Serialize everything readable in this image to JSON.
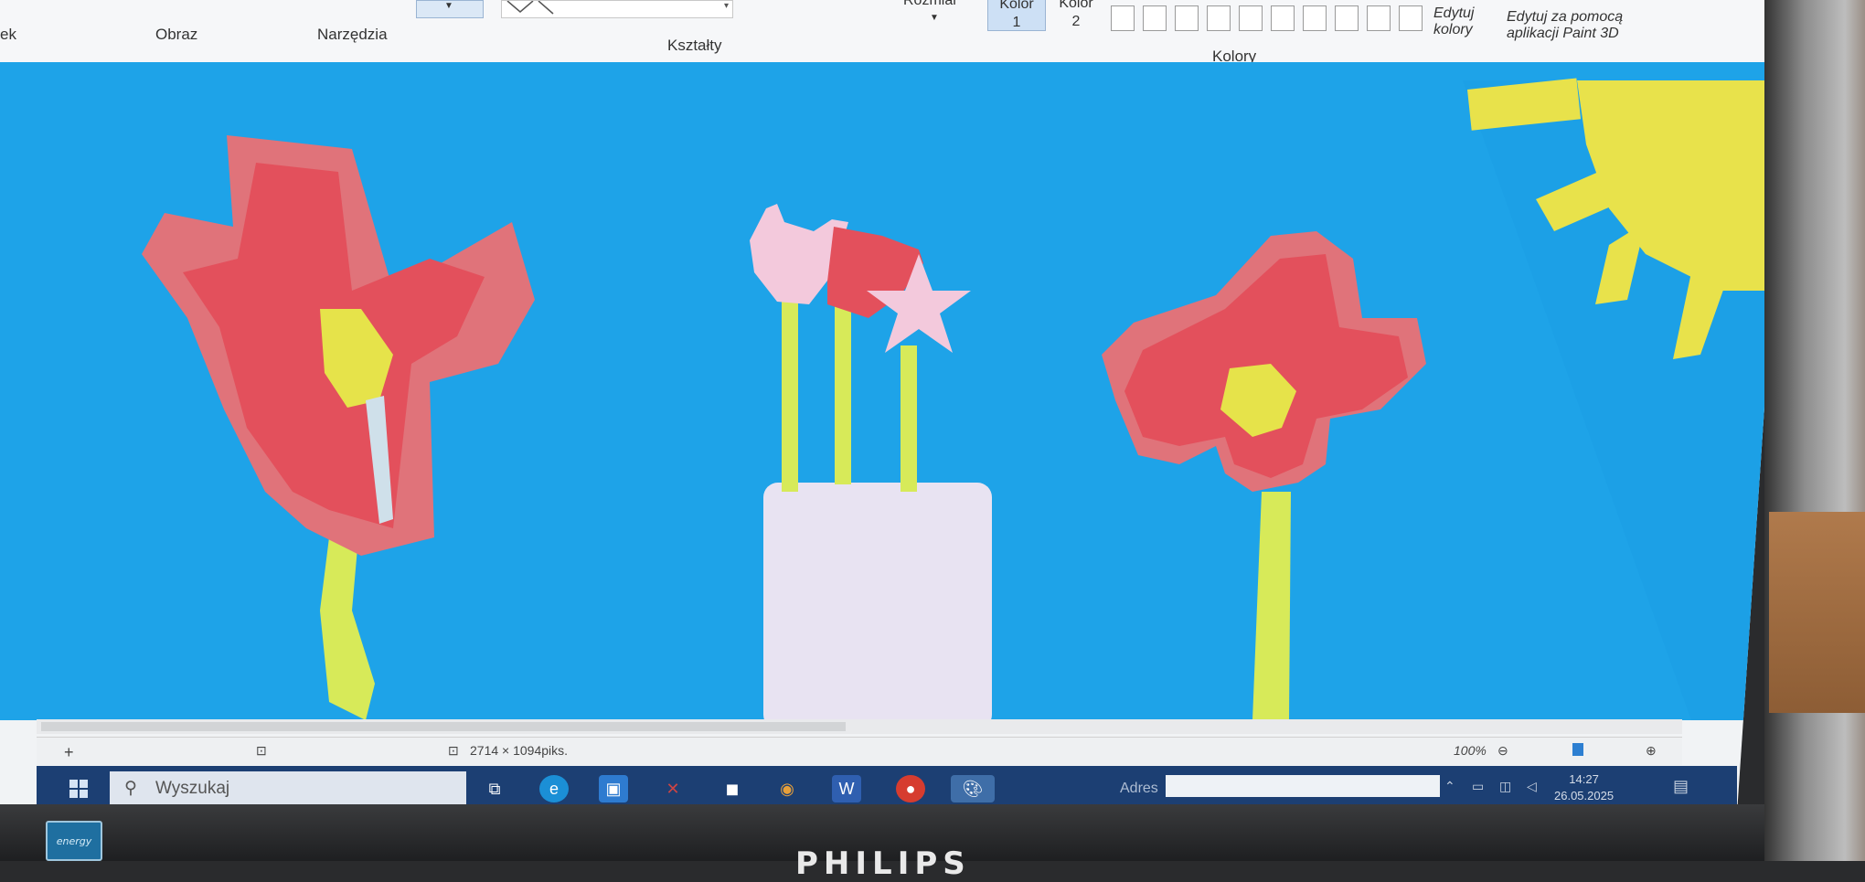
{
  "ribbon": {
    "groups": {
      "obraz": "Obraz",
      "narzedzia": "Narzędzia",
      "ksztalty": "Kształty",
      "kolory": "Kolory",
      "partial_left": "ek"
    },
    "rozmiar": "Rozmiar",
    "kolor1": {
      "top": "Kolor",
      "bottom": "1"
    },
    "kolor2": {
      "top": "Kolor",
      "bottom": "2"
    },
    "edytuj_kolory": {
      "line1": "Edytuj",
      "line2": "kolory"
    },
    "paint3d": {
      "line1": "Edytuj za pomocą",
      "line2": "aplikacji Paint 3D"
    }
  },
  "status": {
    "dimensions": "2714 × 1094piks.",
    "zoom": "100%"
  },
  "taskbar": {
    "search_placeholder": "Wyszukaj",
    "address_label": "Adres",
    "time": "14:27",
    "date": "26.05.2025"
  },
  "monitor": {
    "brand": "PHILIPS"
  },
  "colors": {
    "sky": "#1ea3e8",
    "petal_outer": "#e0737a",
    "petal_inner": "#e3505c",
    "flower_center": "#e6e34a",
    "stem": "#d7ea59",
    "vase": "#e8e3f2",
    "sun": "#e8e24b",
    "star": "#f3c9dc",
    "taskbar": "#1c3f73"
  }
}
